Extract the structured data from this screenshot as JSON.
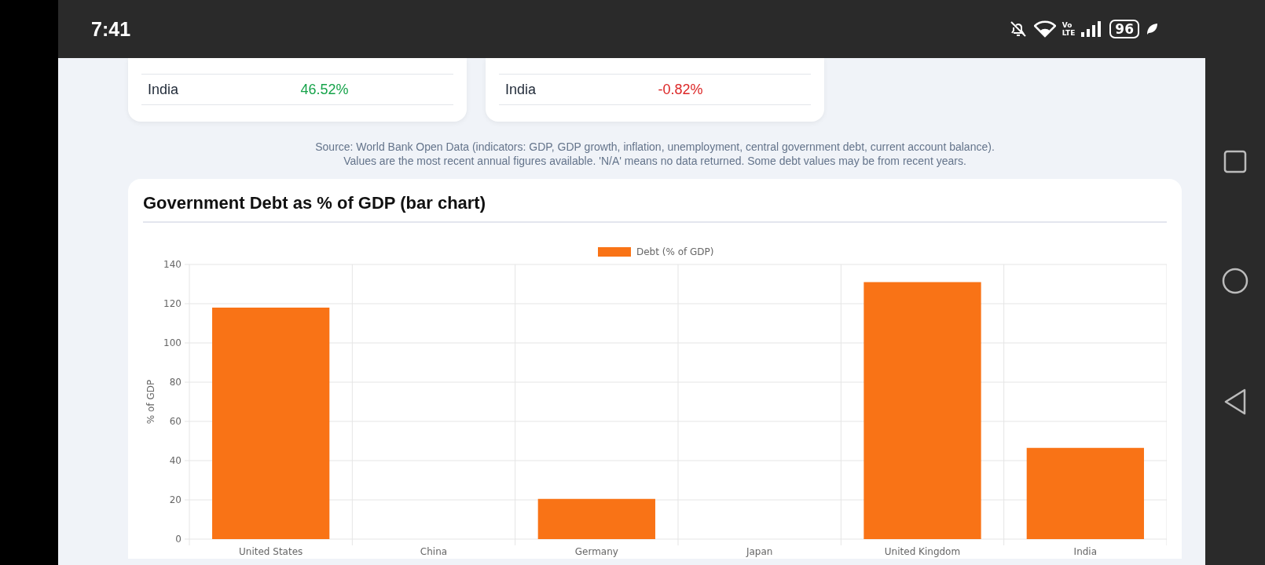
{
  "status_bar": {
    "time": "7:41",
    "network_top": "Vo",
    "network_bottom": "LTE",
    "battery": "96"
  },
  "tables": [
    {
      "rows": [
        {
          "country": "India",
          "value": "46.52%",
          "color": "#16a34a"
        }
      ]
    },
    {
      "rows": [
        {
          "country": "India",
          "value": "-0.82%",
          "color": "#dc2626"
        }
      ]
    }
  ],
  "source_note": [
    "Source: World Bank Open Data (indicators: GDP, GDP growth, inflation, unemployment, central government debt, current account balance).",
    "Values are the most recent annual figures available. 'N/A' means no data returned. Some debt values may be from recent years."
  ],
  "chart_card": {
    "title": "Government Debt as % of GDP (bar chart)",
    "chart_data": {
      "type": "bar",
      "grid": true,
      "ylabel": "% of GDP",
      "categories": [
        "United States",
        "China",
        "Germany",
        "Japan",
        "United Kingdom",
        "India"
      ],
      "series": [
        {
          "name": "Debt (% of GDP)",
          "color": "#f97316",
          "values": [
            118,
            null,
            20.5,
            null,
            131,
            46.5
          ]
        }
      ],
      "ylim": [
        0,
        140
      ],
      "yticks": [
        0,
        20,
        40,
        60,
        80,
        100,
        120,
        140
      ]
    }
  }
}
